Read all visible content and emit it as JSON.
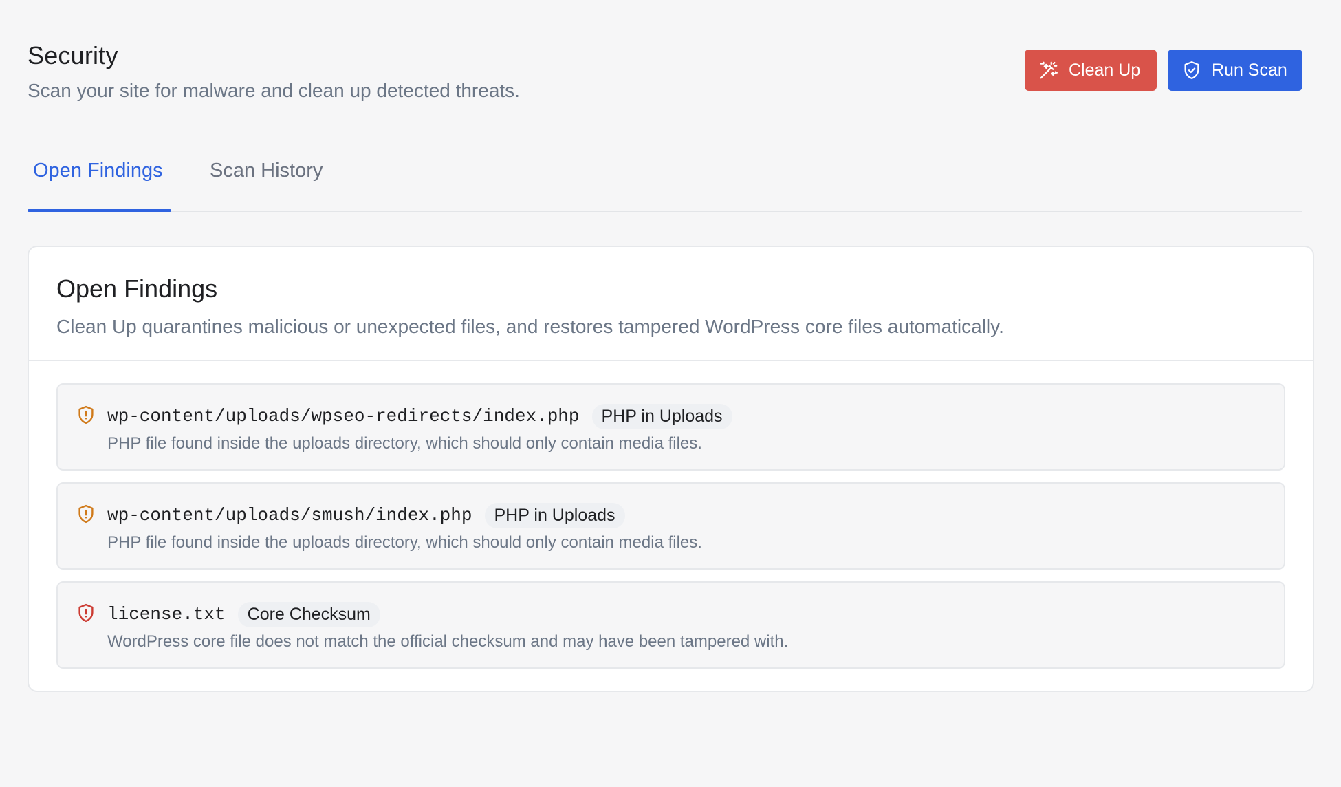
{
  "header": {
    "title": "Security",
    "subtitle": "Scan your site for malware and clean up detected threats."
  },
  "actions": {
    "cleanup_label": "Clean Up",
    "scan_label": "Run Scan",
    "cleanup_color": "#d9534a",
    "scan_color": "#2f63e0",
    "cleanup_icon": "magic-wand-icon",
    "scan_icon": "shield-check-icon"
  },
  "tabs": [
    {
      "label": "Open Findings",
      "active": true
    },
    {
      "label": "Scan History",
      "active": false
    }
  ],
  "card": {
    "title": "Open Findings",
    "description": "Clean Up quarantines malicious or unexpected files, and restores tampered WordPress core files automatically."
  },
  "findings": [
    {
      "path": "wp-content/uploads/wpseo-redirects/index.php",
      "tag": "PHP in Uploads",
      "description": "PHP file found inside the uploads directory, which should only contain media files.",
      "severity_color": "#d07a1a",
      "icon": "shield-alert-icon"
    },
    {
      "path": "wp-content/uploads/smush/index.php",
      "tag": "PHP in Uploads",
      "description": "PHP file found inside the uploads directory, which should only contain media files.",
      "severity_color": "#d07a1a",
      "icon": "shield-alert-icon"
    },
    {
      "path": "license.txt",
      "tag": "Core Checksum",
      "description": "WordPress core file does not match the official checksum and may have been tampered with.",
      "severity_color": "#cc3b32",
      "icon": "shield-alert-icon"
    }
  ]
}
